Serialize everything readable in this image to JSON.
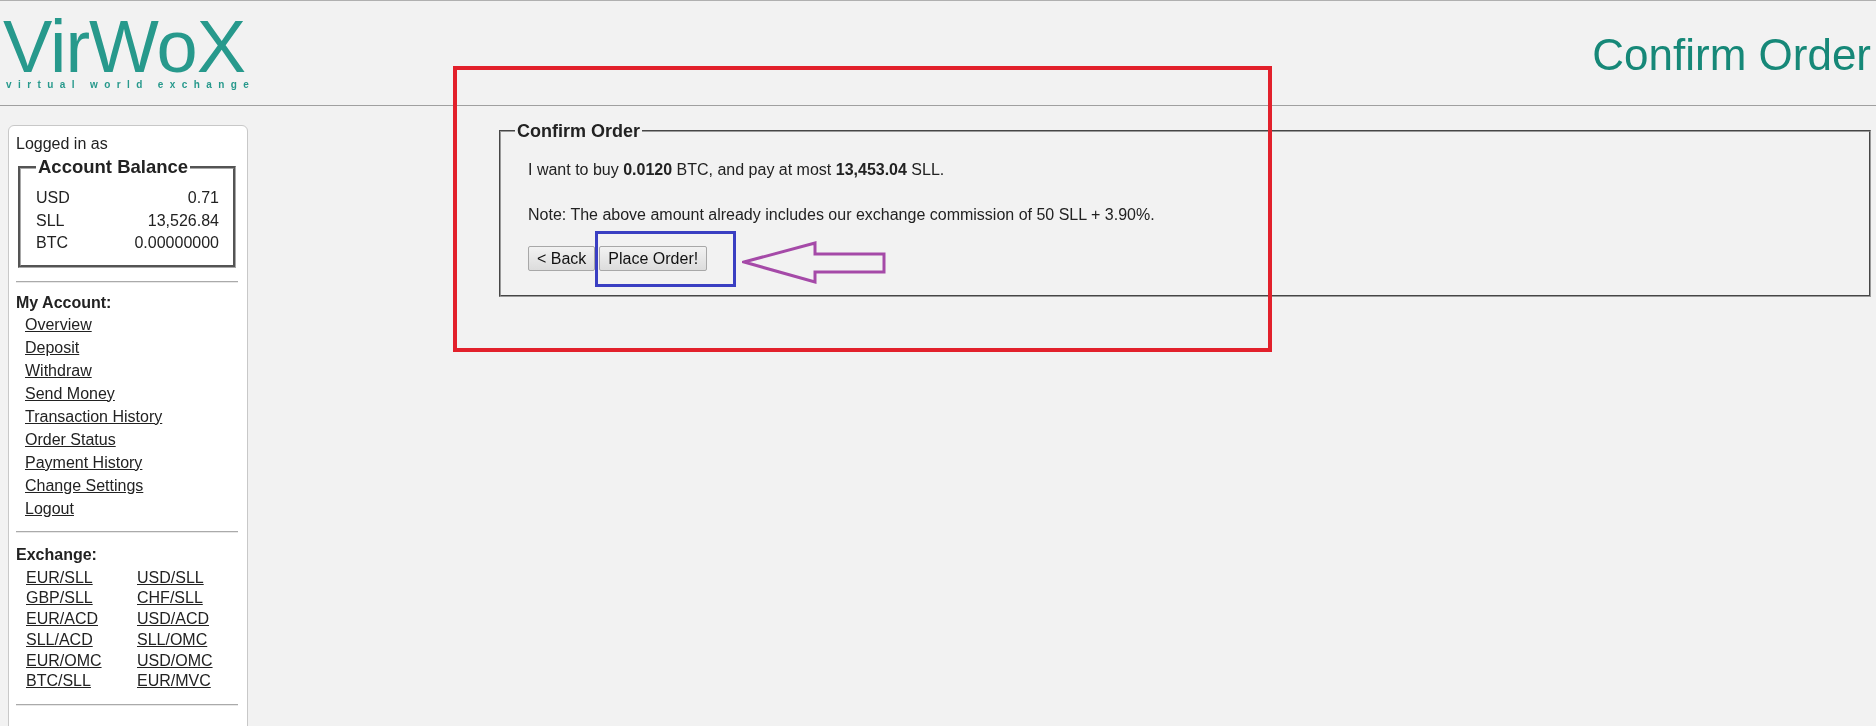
{
  "header": {
    "logo": {
      "name": "VirWoX",
      "tagline": "virtual world exchange"
    },
    "title": "Confirm Order"
  },
  "sidebar": {
    "logged_in_label": "Logged in as",
    "account_balance": {
      "title": "Account Balance",
      "rows": [
        {
          "currency": "USD",
          "amount": "0.71"
        },
        {
          "currency": "SLL",
          "amount": "13,526.84"
        },
        {
          "currency": "BTC",
          "amount": "0.00000000"
        }
      ]
    },
    "my_account": {
      "heading": "My Account:",
      "links": [
        "Overview",
        "Deposit",
        "Withdraw",
        "Send Money",
        "Transaction History",
        "Order Status",
        "Payment History",
        "Change Settings",
        "Logout"
      ]
    },
    "exchange": {
      "heading": "Exchange:",
      "pairs": [
        "EUR/SLL",
        "USD/SLL",
        "GBP/SLL",
        "CHF/SLL",
        "EUR/ACD",
        "USD/ACD",
        "SLL/ACD",
        "SLL/OMC",
        "EUR/OMC",
        "USD/OMC",
        "BTC/SLL",
        "EUR/MVC"
      ]
    }
  },
  "confirm_order": {
    "legend": "Confirm Order",
    "summary": "I want to buy **0.0120** BTC, and pay at most **13,453.04** SLL.",
    "note": "Note: The above amount already includes our exchange commission of 50 SLL + 3.90%.",
    "back_button": "< Back",
    "place_order_button": "Place Order!"
  }
}
